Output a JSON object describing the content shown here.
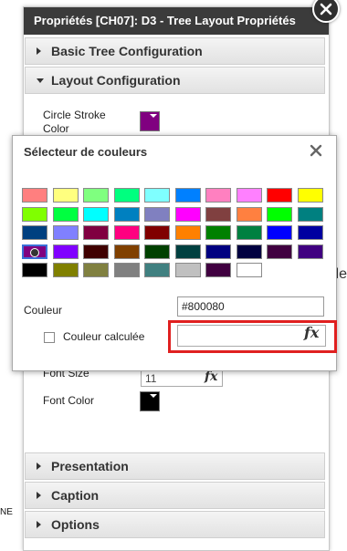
{
  "panel": {
    "title": "Propriétés [CH07]: D3 - Tree Layout Propriétés",
    "sections": {
      "basic": "Basic Tree Configuration",
      "layout": "Layout Configuration",
      "presentation": "Presentation",
      "caption": "Caption",
      "options": "Options"
    },
    "fields": {
      "circle_stroke_color": "Circle Stroke Color",
      "circle_stroke_color_value": "#800080",
      "font_size": "Font Size",
      "font_size_value": "11",
      "font_color": "Font Color",
      "font_color_value": "#000000"
    }
  },
  "background": {
    "left_text": "NE",
    "right_text": "le"
  },
  "picker": {
    "title": "Sélecteur de couleurs",
    "couleur_label": "Couleur",
    "couleur_value": "#800080",
    "calc_label": "Couleur calculée",
    "calc_value": "",
    "fx_label": "fx",
    "selected_index": 30,
    "colors": [
      "#ff7f7f",
      "#ffff7f",
      "#7fff7f",
      "#00ff7f",
      "#7fffff",
      "#0080ff",
      "#ff80c0",
      "#ff80ff",
      "#ff0000",
      "#ffff00",
      "#80ff00",
      "#00ff40",
      "#00ffff",
      "#0080c0",
      "#8080c0",
      "#ff00ff",
      "#804040",
      "#ff8040",
      "#00ff00",
      "#008080",
      "#004080",
      "#8080ff",
      "#800040",
      "#ff0080",
      "#800000",
      "#ff8000",
      "#008000",
      "#008040",
      "#0000ff",
      "#0000a0",
      "#800080",
      "#8000ff",
      "#400000",
      "#804000",
      "#004000",
      "#004040",
      "#000080",
      "#000040",
      "#400040",
      "#400080",
      "#000000",
      "#808000",
      "#808040",
      "#808080",
      "#408080",
      "#c0c0c0",
      "#400040",
      "#ffffff"
    ]
  }
}
